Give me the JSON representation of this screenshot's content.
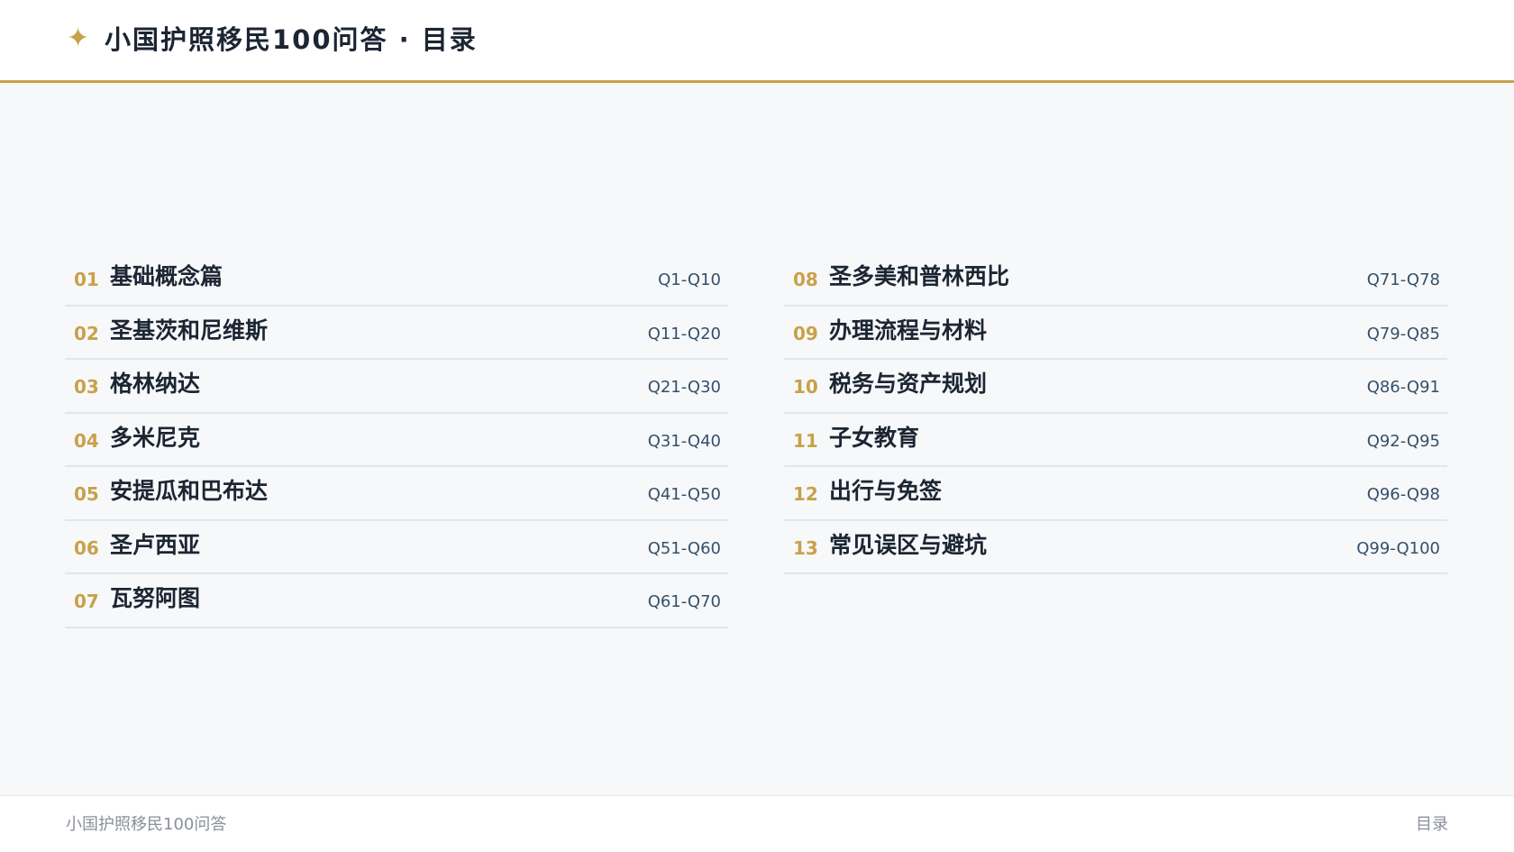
{
  "colors": {
    "accent": "#c9a14a",
    "title_text": "#1c2533",
    "range_text": "#33506b",
    "footer_text": "#8a9099",
    "background": "#f7f8f9"
  },
  "header": {
    "icon": "star-icon",
    "star_glyph": "✦",
    "title": "小国护照移民100问答 · 目录"
  },
  "toc": {
    "left": [
      {
        "num": "01",
        "title": "基础概念篇",
        "range": "Q1-Q10"
      },
      {
        "num": "02",
        "title": "圣基茨和尼维斯",
        "range": "Q11-Q20"
      },
      {
        "num": "03",
        "title": "格林纳达",
        "range": "Q21-Q30"
      },
      {
        "num": "04",
        "title": "多米尼克",
        "range": "Q31-Q40"
      },
      {
        "num": "05",
        "title": "安提瓜和巴布达",
        "range": "Q41-Q50"
      },
      {
        "num": "06",
        "title": "圣卢西亚",
        "range": "Q51-Q60"
      },
      {
        "num": "07",
        "title": "瓦努阿图",
        "range": "Q61-Q70"
      }
    ],
    "right": [
      {
        "num": "08",
        "title": "圣多美和普林西比",
        "range": "Q71-Q78"
      },
      {
        "num": "09",
        "title": "办理流程与材料",
        "range": "Q79-Q85"
      },
      {
        "num": "10",
        "title": "税务与资产规划",
        "range": "Q86-Q91"
      },
      {
        "num": "11",
        "title": "子女教育",
        "range": "Q92-Q95"
      },
      {
        "num": "12",
        "title": "出行与免签",
        "range": "Q96-Q98"
      },
      {
        "num": "13",
        "title": "常见误区与避坑",
        "range": "Q99-Q100"
      }
    ]
  },
  "footer": {
    "left": "小国护照移民100问答",
    "right": "目录"
  }
}
